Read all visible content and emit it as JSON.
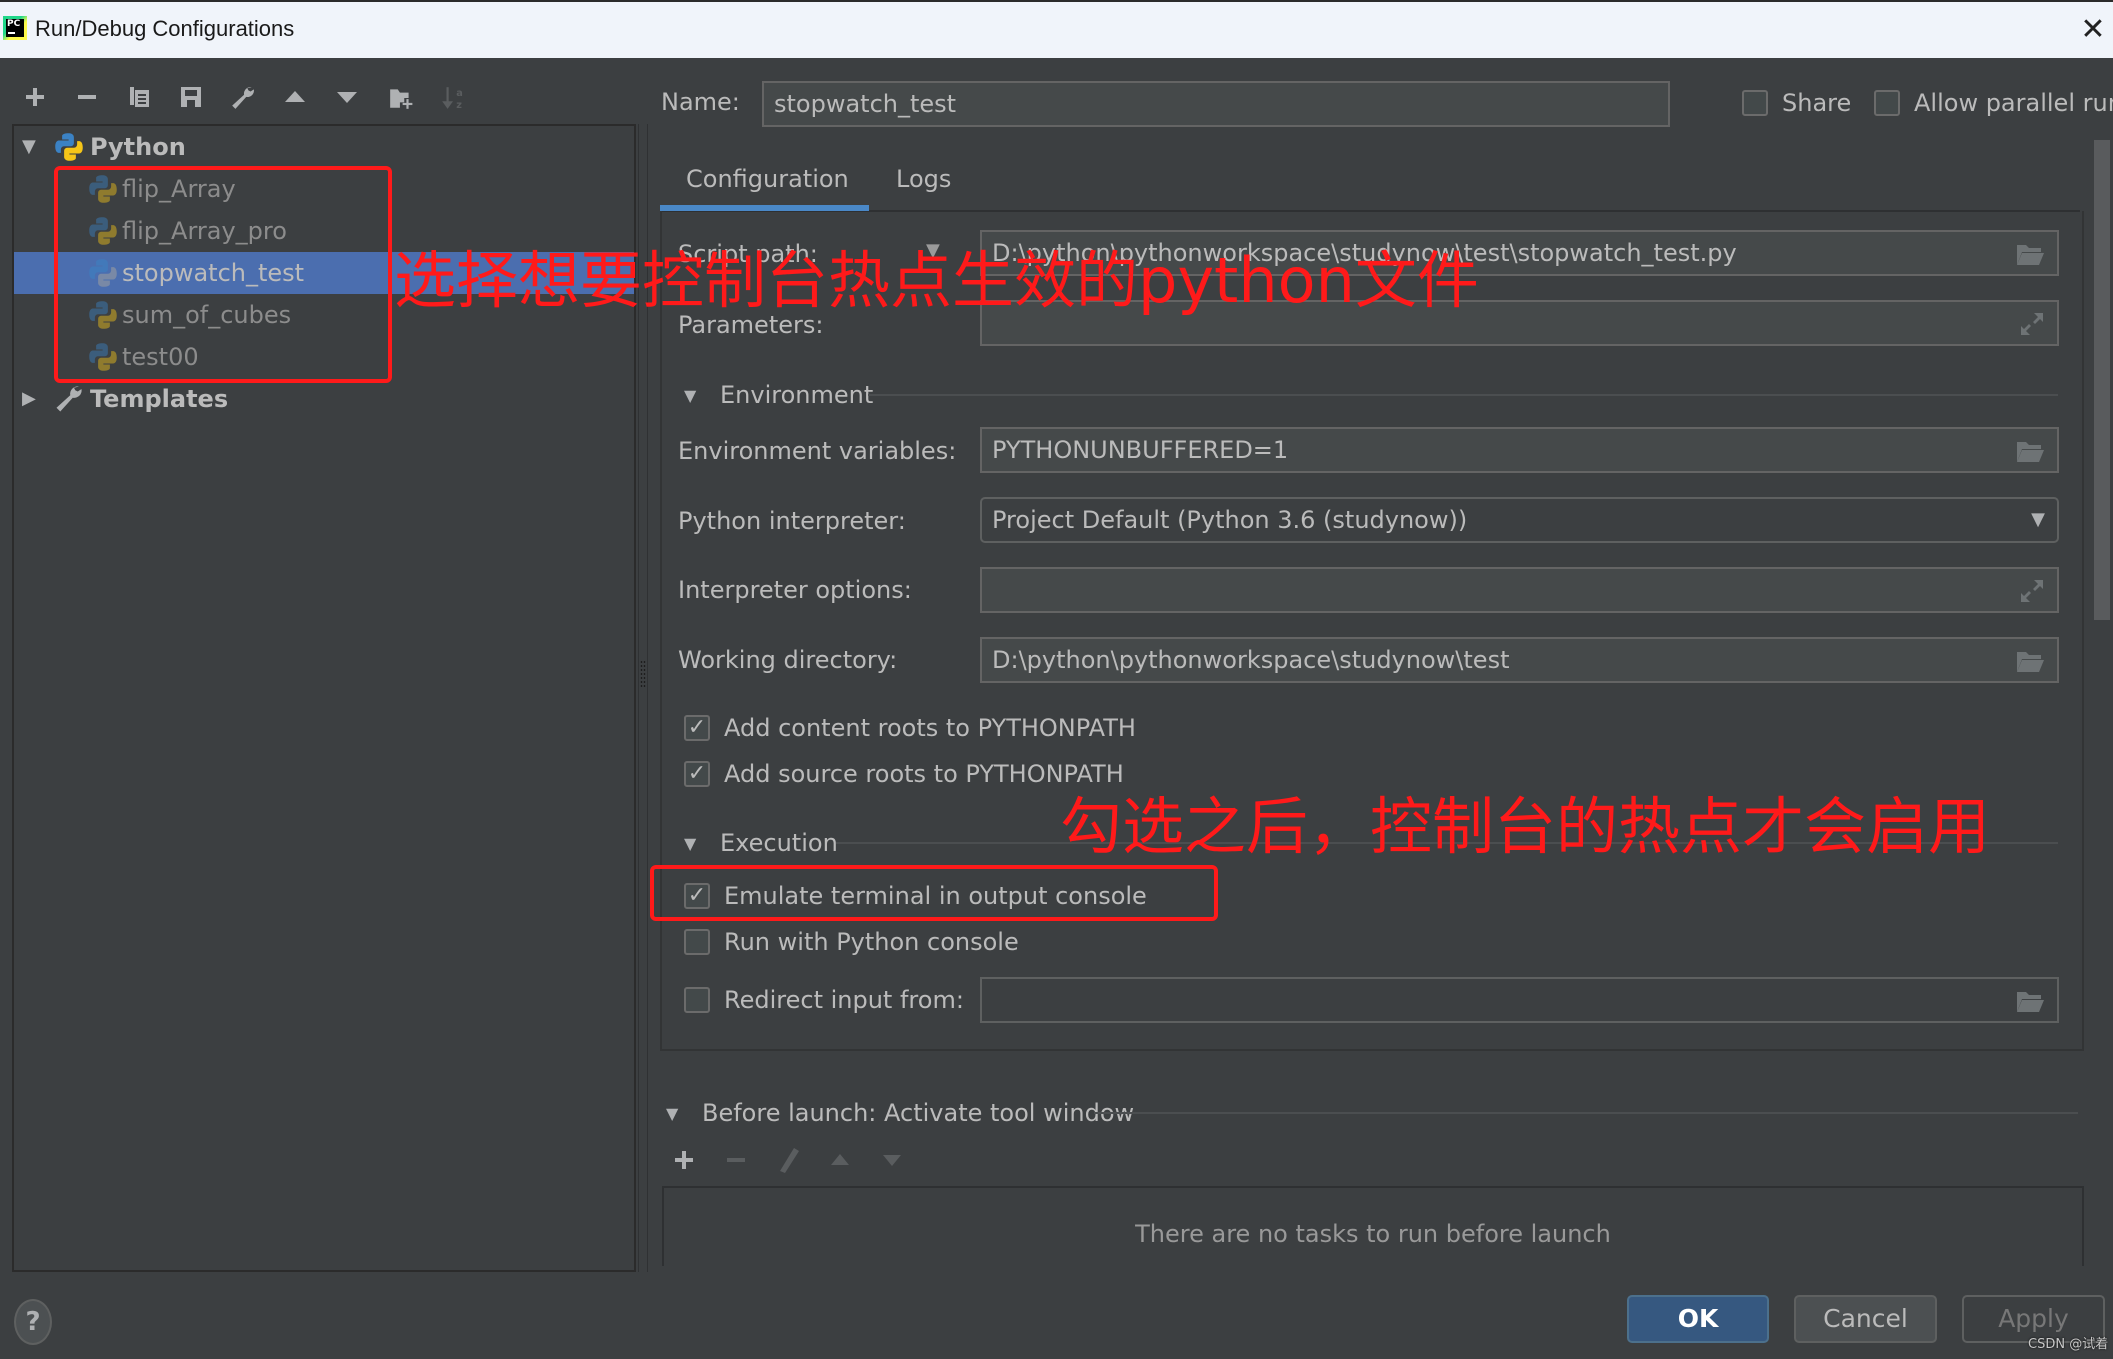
{
  "window": {
    "title": "Run/Debug Configurations",
    "app_icon_text": "PC",
    "close_glyph": "✕"
  },
  "toolbar": {
    "items": [
      {
        "name": "add",
        "icon": "plus-icon",
        "enabled": true
      },
      {
        "name": "remove",
        "icon": "minus-icon",
        "enabled": true
      },
      {
        "name": "copy",
        "icon": "copy-icon",
        "enabled": true
      },
      {
        "name": "save",
        "icon": "save-icon",
        "enabled": true
      },
      {
        "name": "edit-defaults",
        "icon": "wrench-icon",
        "enabled": true
      },
      {
        "name": "move-up",
        "icon": "arrow-up-icon",
        "enabled": true
      },
      {
        "name": "move-down",
        "icon": "arrow-down-icon",
        "enabled": true
      },
      {
        "name": "new-folder",
        "icon": "folder-add-icon",
        "enabled": true
      },
      {
        "name": "sort",
        "icon": "sort-alpha-icon",
        "enabled": false
      }
    ]
  },
  "tree": {
    "groups": [
      {
        "label": "Python",
        "expanded": true,
        "icon": "python-icon",
        "items": [
          {
            "label": "flip_Array",
            "selected": false
          },
          {
            "label": "flip_Array_pro",
            "selected": false
          },
          {
            "label": "stopwatch_test",
            "selected": true
          },
          {
            "label": "sum_of_cubes",
            "selected": false
          },
          {
            "label": "test00",
            "selected": false
          }
        ]
      },
      {
        "label": "Templates",
        "expanded": false,
        "icon": "wrench-icon",
        "items": []
      }
    ]
  },
  "header": {
    "name_label": "Name:",
    "name_value": "stopwatch_test",
    "share_label": "Share",
    "share_checked": false,
    "allow_parallel_label": "Allow parallel run",
    "allow_parallel_checked": false
  },
  "tabs": [
    {
      "label": "Configuration",
      "active": true
    },
    {
      "label": "Logs",
      "active": false
    }
  ],
  "config": {
    "script_path_label": "Script path:",
    "script_path_value": "D:\\python\\pythonworkspace\\studynow\\test\\stopwatch_test.py",
    "parameters_label": "Parameters:",
    "parameters_value": "",
    "environment_section": "Environment",
    "env_vars_label": "Environment variables:",
    "env_vars_value": "PYTHONUNBUFFERED=1",
    "interpreter_label": "Python interpreter:",
    "interpreter_value": "Project Default (Python 3.6 (studynow))",
    "interpreter_options_label": "Interpreter options:",
    "interpreter_options_value": "",
    "working_dir_label": "Working directory:",
    "working_dir_value": "D:\\python\\pythonworkspace\\studynow\\test",
    "add_content_roots_label": "Add content roots to PYTHONPATH",
    "add_content_roots_checked": true,
    "add_source_roots_label": "Add source roots to PYTHONPATH",
    "add_source_roots_checked": true,
    "execution_section": "Execution",
    "emulate_terminal_label": "Emulate terminal in output console",
    "emulate_terminal_checked": true,
    "run_with_console_label": "Run with Python console",
    "run_with_console_checked": false,
    "redirect_input_label": "Redirect input from:",
    "redirect_input_checked": false,
    "redirect_input_value": ""
  },
  "before_launch": {
    "section_label": "Before launch: Activate tool window",
    "empty_text": "There are no tasks to run before launch",
    "tools": [
      {
        "icon": "plus-icon",
        "enabled": true
      },
      {
        "icon": "minus-icon",
        "enabled": false
      },
      {
        "icon": "pencil-icon",
        "enabled": false
      },
      {
        "icon": "arrow-up-icon",
        "enabled": false
      },
      {
        "icon": "arrow-down-icon",
        "enabled": false
      }
    ]
  },
  "footer": {
    "help_glyph": "?",
    "ok_label": "OK",
    "cancel_label": "Cancel",
    "apply_label": "Apply",
    "apply_enabled": false
  },
  "annotations": {
    "select_file_note": "选择想要控制台热点生效的python文件",
    "checkbox_note": "勾选之后，控制台的热点才会启用",
    "color": "#ff1a1a"
  },
  "watermark": "CSDN @试着",
  "colors": {
    "selection": "#4b6eaf",
    "tab_accent": "#4a88c7",
    "primary_button": "#365880",
    "background": "#3c3f41"
  }
}
